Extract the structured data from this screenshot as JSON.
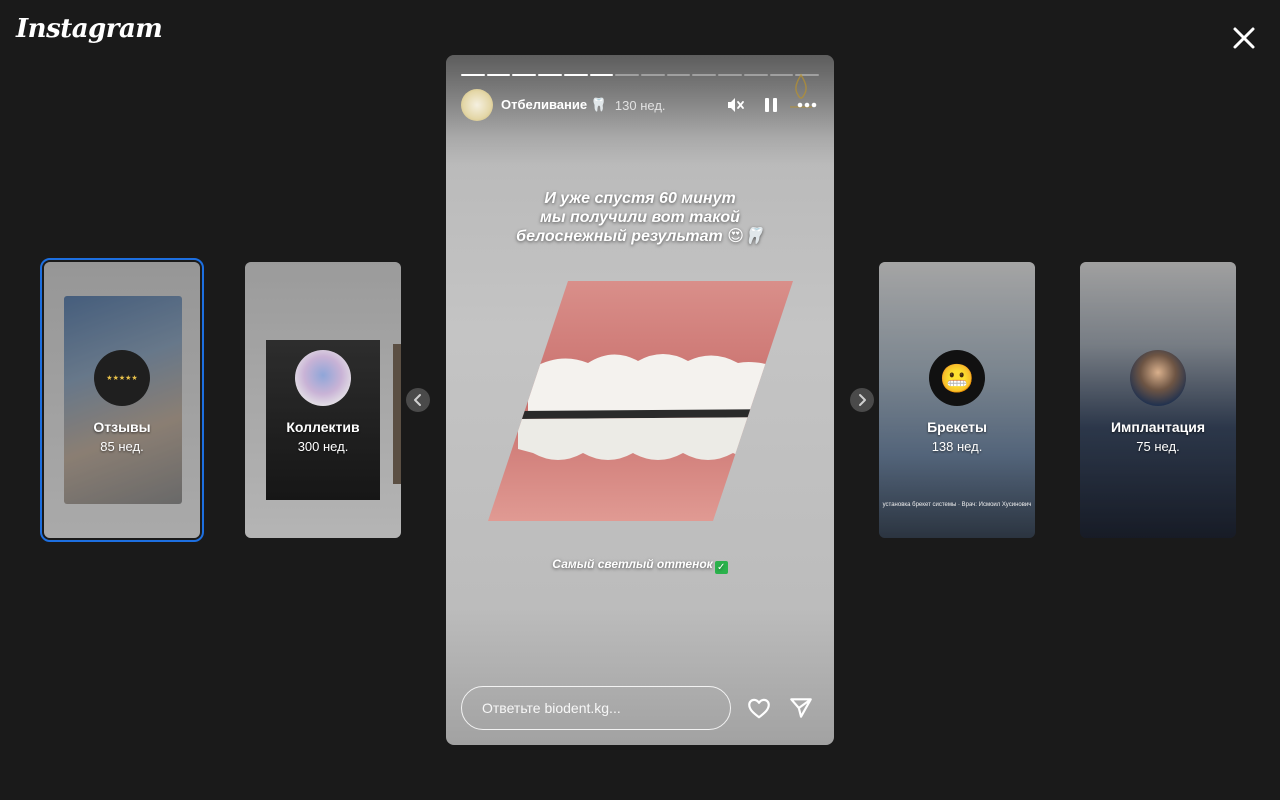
{
  "app": {
    "logo": "Instagram"
  },
  "previews": [
    {
      "name": "Отзывы",
      "ago": "85 нед.",
      "stars": "★★★★★"
    },
    {
      "name": "Коллектив",
      "ago": "300 нед."
    },
    {
      "name": "Брекеты",
      "ago": "138 нед.",
      "avatar_emoji": "😬",
      "caption": "установка брекет системы · Врач: Исмоил Хусинович"
    },
    {
      "name": "Имплантация",
      "ago": "75 нед."
    }
  ],
  "story": {
    "title": "Отбеливание 🦷",
    "time": "130 нед.",
    "progress": {
      "total": 14,
      "completed": 6
    },
    "headline_lines": [
      "И уже спустя 60 минут",
      "мы получили вот такой",
      "белоснежный результат 😍🦷"
    ],
    "subline": "Самый светлый оттенок",
    "subline_check": "✓",
    "reply_placeholder": "Ответьте biodent.kg..."
  },
  "icons": {
    "close": "close-icon",
    "mute": "speaker-muted-icon",
    "pause": "pause-icon",
    "more": "more-icon",
    "like": "heart-icon",
    "share": "send-icon",
    "prev": "chevron-left-icon",
    "next": "chevron-right-icon"
  },
  "colors": {
    "background": "#1a1a1a",
    "selected_outline": "#1d6fe0",
    "check": "#2bb24c"
  }
}
